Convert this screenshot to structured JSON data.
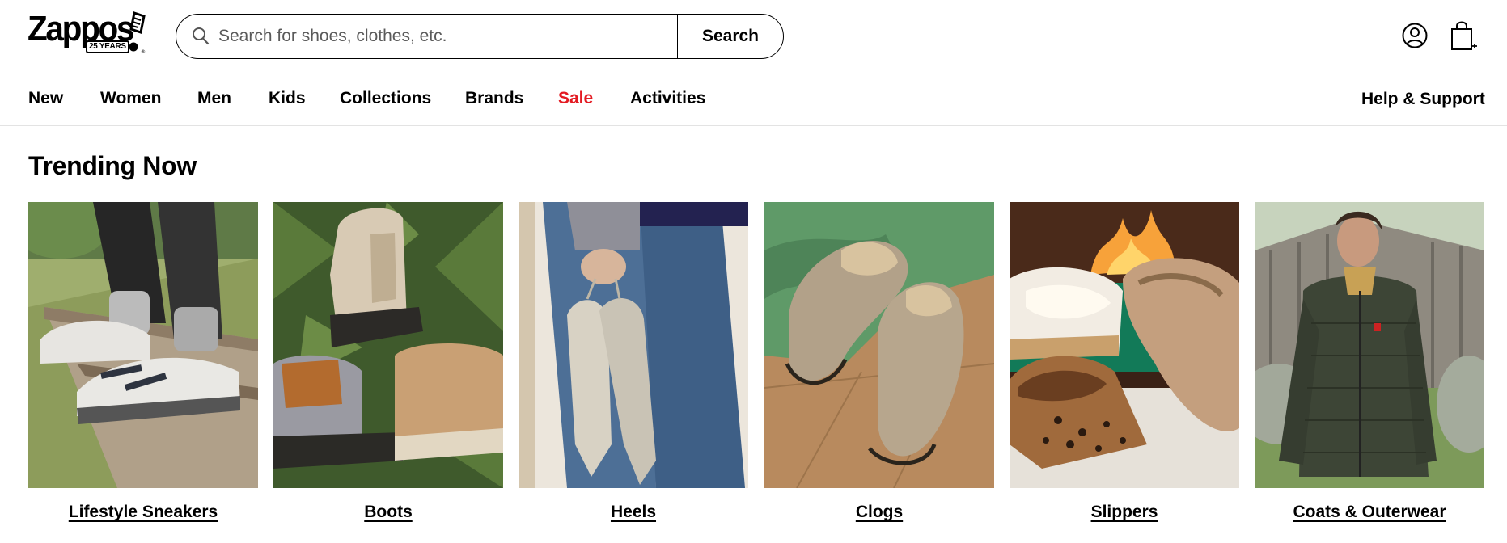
{
  "brand": {
    "logo_text": "Zappos",
    "logo_badge": "25 YEARS"
  },
  "search": {
    "placeholder": "Search for shoes, clothes, etc.",
    "value": "",
    "button_label": "Search"
  },
  "header_icons": [
    "account-icon",
    "shopping-bag-icon"
  ],
  "nav": {
    "items": [
      {
        "label": "New"
      },
      {
        "label": "Women"
      },
      {
        "label": "Men"
      },
      {
        "label": "Kids"
      },
      {
        "label": "Collections"
      },
      {
        "label": "Brands"
      },
      {
        "label": "Sale"
      },
      {
        "label": "Activities"
      }
    ],
    "help_label": "Help & Support"
  },
  "trending": {
    "title": "Trending Now",
    "cards": [
      {
        "label": "Lifestyle Sneakers"
      },
      {
        "label": "Boots"
      },
      {
        "label": "Heels"
      },
      {
        "label": "Clogs"
      },
      {
        "label": "Slippers"
      },
      {
        "label": "Coats & Outerwear"
      }
    ]
  },
  "colors": {
    "text": "#000000",
    "sale": "#e31b23",
    "divider": "#e3e3e3"
  }
}
